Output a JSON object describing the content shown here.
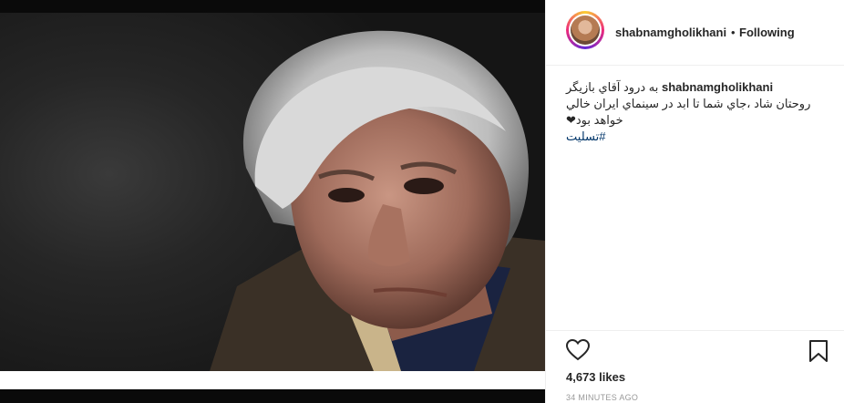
{
  "post": {
    "username": "shabnamgholikhani",
    "separator": "•",
    "follow_status": "Following",
    "caption_user": "shabnamgholikhani",
    "caption_line1": "به درود آقاي بازيگر",
    "caption_line2": "روحتان شاد ،جاي شما تا ابد در سينماي ايران خالي",
    "caption_line3": "خواهد بود❤",
    "hashtag": "#تسليت",
    "likes": "4,673 likes",
    "time": "34 MINUTES AGO"
  },
  "icons": {
    "like": "heart-icon",
    "save": "bookmark-icon",
    "avatar": "profile-avatar"
  },
  "colors": {
    "text": "#262626",
    "muted": "#999999",
    "hashtag": "#003569",
    "divider": "#efefef"
  }
}
